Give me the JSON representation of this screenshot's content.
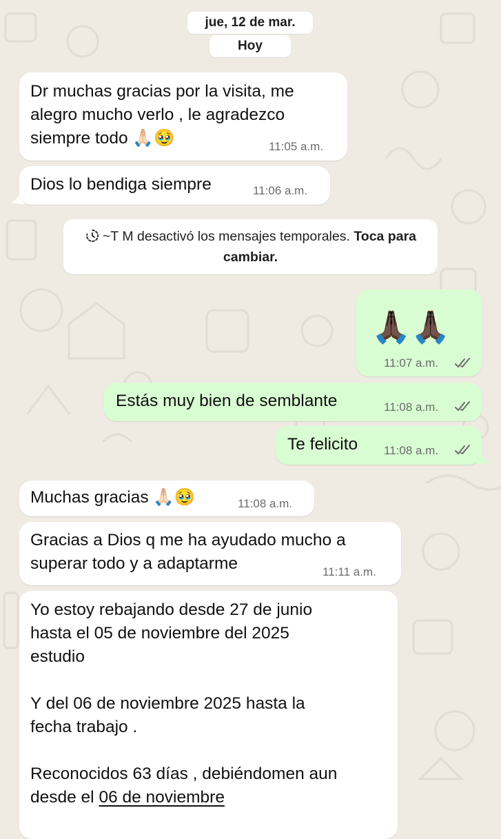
{
  "date_chips": {
    "date": "jue, 12 de mar.",
    "today": "Hoy"
  },
  "system_notice": {
    "text": "~T M desactivó los mensajes temporales.",
    "action": "Toca para cambiar."
  },
  "messages": [
    {
      "direction": "incoming",
      "lines": [
        "Dr muchas gracias por la visita, me",
        "alegro mucho verlo , le agradezco",
        "siempre todo 🙏🏻🥹"
      ],
      "time": "11:05 a.m."
    },
    {
      "direction": "incoming",
      "lines": [
        "Dios lo bendiga siempre"
      ],
      "time": "11:06 a.m."
    },
    {
      "direction": "outgoing",
      "lines": [
        "🙏🏿🙏🏿"
      ],
      "time": "11:07 a.m.",
      "status": "read"
    },
    {
      "direction": "outgoing",
      "lines": [
        "Estás muy bien de semblante"
      ],
      "time": "11:08 a.m.",
      "status": "read"
    },
    {
      "direction": "outgoing",
      "lines": [
        "Te felicito"
      ],
      "time": "11:08 a.m.",
      "status": "read"
    },
    {
      "direction": "incoming",
      "lines": [
        "Muchas gracias 🙏🏻🥹"
      ],
      "time": "11:08 a.m."
    },
    {
      "direction": "incoming",
      "lines": [
        "Gracias a Dios q me ha ayudado mucho a",
        "superar todo y a adaptarme"
      ],
      "time": "11:11 a.m."
    },
    {
      "direction": "incoming",
      "lines": [
        "Yo estoy rebajando desde 27 de junio",
        "hasta el 05 de noviembre del 2025",
        "estudio",
        "",
        "Y del 06 de noviembre 2025 hasta la",
        "fecha trabajo .",
        "",
        "Reconocidos 63 días , debiéndomen aun"
      ],
      "last_line_prefix": "desde el ",
      "last_line_link": "06 de noviembre"
    }
  ],
  "colors": {
    "wallpaper": "#EFEAE2",
    "incoming_bubble": "#FFFFFF",
    "outgoing_bubble": "#D9FDD3",
    "read_ticks": "#6b6b6b"
  },
  "icons": {
    "timer": "disappearing-timer-icon",
    "ticks": "double-check-icon"
  }
}
